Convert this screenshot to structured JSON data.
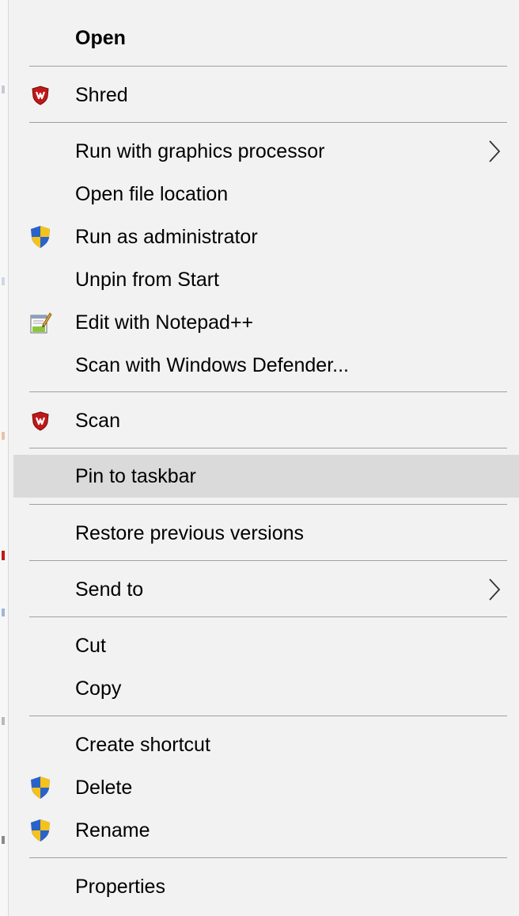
{
  "menu": {
    "items": {
      "open": {
        "label": "Open"
      },
      "shred": {
        "label": "Shred",
        "icon": "mcafee-shield-icon"
      },
      "run_gpu": {
        "label": "Run with graphics processor",
        "has_submenu": true
      },
      "open_location": {
        "label": "Open file location"
      },
      "run_admin": {
        "label": "Run as administrator",
        "icon": "uac-shield-icon"
      },
      "unpin_start": {
        "label": "Unpin from Start"
      },
      "edit_notepad": {
        "label": "Edit with Notepad++",
        "icon": "notepad-plus-plus-icon"
      },
      "scan_defender": {
        "label": "Scan with Windows Defender..."
      },
      "scan": {
        "label": "Scan",
        "icon": "mcafee-shield-icon"
      },
      "pin_taskbar": {
        "label": "Pin to taskbar",
        "highlighted": true
      },
      "restore_versions": {
        "label": "Restore previous versions"
      },
      "send_to": {
        "label": "Send to",
        "has_submenu": true
      },
      "cut": {
        "label": "Cut"
      },
      "copy": {
        "label": "Copy"
      },
      "create_shortcut": {
        "label": "Create shortcut"
      },
      "delete": {
        "label": "Delete",
        "icon": "uac-shield-icon"
      },
      "rename": {
        "label": "Rename",
        "icon": "uac-shield-icon"
      },
      "properties": {
        "label": "Properties"
      }
    }
  },
  "colors": {
    "menu_background": "#f2f2f2",
    "highlight_background": "#dadada",
    "separator": "#a0a0a0",
    "mcafee_red": "#c01818",
    "uac_blue": "#2a62c8",
    "uac_yellow": "#f4c21a"
  }
}
